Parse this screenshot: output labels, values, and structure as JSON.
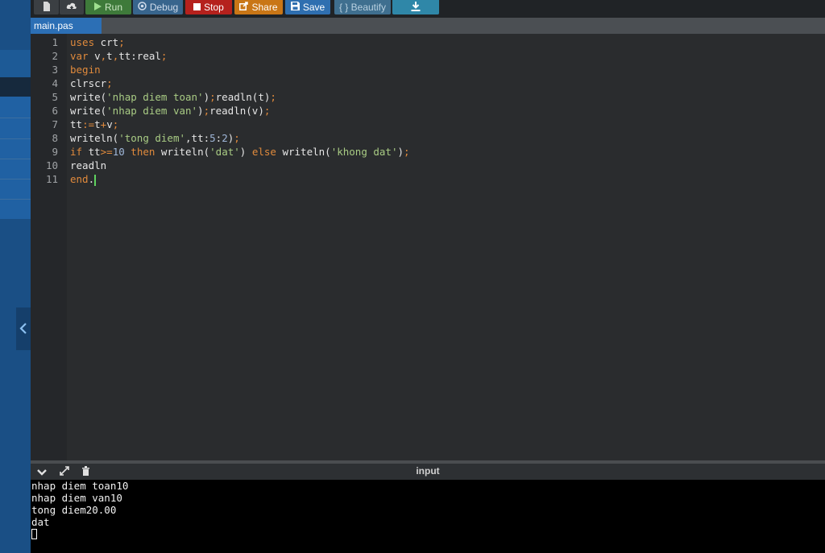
{
  "toolbar": {
    "buttons": [
      {
        "id": "new-file",
        "label": "",
        "icon": "file-icon",
        "color": "#3b3f43"
      },
      {
        "id": "upload",
        "label": "",
        "icon": "upload-cloud-icon",
        "color": "#3b3f43"
      },
      {
        "id": "run",
        "label": "Run",
        "icon": "play-icon",
        "color": "#3e7a3a"
      },
      {
        "id": "debug",
        "label": "Debug",
        "icon": "debug-icon",
        "color": "#38658d"
      },
      {
        "id": "stop",
        "label": "Stop",
        "icon": "stop-icon",
        "color": "#b5211d"
      },
      {
        "id": "share",
        "label": "Share",
        "icon": "share-icon",
        "color": "#c97616"
      },
      {
        "id": "save",
        "label": "Save",
        "icon": "floppy-icon",
        "color": "#2f6fb0"
      },
      {
        "id": "beautify",
        "label": "{ } Beautify",
        "icon": "",
        "color": "#3f6f8f"
      },
      {
        "id": "download",
        "label": "",
        "icon": "download-icon",
        "color": "#2f87a8"
      }
    ]
  },
  "tab": {
    "label": "main.pas"
  },
  "code": {
    "line_numbers": [
      "1",
      "2",
      "3",
      "4",
      "5",
      "6",
      "7",
      "8",
      "9",
      "10",
      "11"
    ],
    "lines": [
      [
        {
          "t": "uses",
          "c": "kw"
        },
        {
          "t": " crt",
          "c": ""
        },
        {
          "t": ";",
          "c": "op"
        }
      ],
      [
        {
          "t": "var",
          "c": "kw"
        },
        {
          "t": " v",
          "c": ""
        },
        {
          "t": ",",
          "c": "op"
        },
        {
          "t": "t",
          "c": ""
        },
        {
          "t": ",",
          "c": "op"
        },
        {
          "t": "tt:real",
          "c": ""
        },
        {
          "t": ";",
          "c": "op"
        }
      ],
      [
        {
          "t": "begin",
          "c": "kw"
        }
      ],
      [
        {
          "t": "clrscr",
          "c": ""
        },
        {
          "t": ";",
          "c": "op"
        }
      ],
      [
        {
          "t": "write(",
          "c": ""
        },
        {
          "t": "'nhap diem toan'",
          "c": "str"
        },
        {
          "t": ")",
          "c": ""
        },
        {
          "t": ";",
          "c": "op"
        },
        {
          "t": "readln(t)",
          "c": ""
        },
        {
          "t": ";",
          "c": "op"
        }
      ],
      [
        {
          "t": "write(",
          "c": ""
        },
        {
          "t": "'nhap diem van'",
          "c": "str"
        },
        {
          "t": ")",
          "c": ""
        },
        {
          "t": ";",
          "c": "op"
        },
        {
          "t": "readln(v)",
          "c": ""
        },
        {
          "t": ";",
          "c": "op"
        }
      ],
      [
        {
          "t": "tt",
          "c": ""
        },
        {
          "t": ":=",
          "c": "op"
        },
        {
          "t": "t",
          "c": ""
        },
        {
          "t": "+",
          "c": "op"
        },
        {
          "t": "v",
          "c": ""
        },
        {
          "t": ";",
          "c": "op"
        }
      ],
      [
        {
          "t": "writeln(",
          "c": ""
        },
        {
          "t": "'tong diem'",
          "c": "str"
        },
        {
          "t": ",tt:",
          "c": ""
        },
        {
          "t": "5",
          "c": "num"
        },
        {
          "t": ":",
          "c": ""
        },
        {
          "t": "2",
          "c": "num"
        },
        {
          "t": ")",
          "c": ""
        },
        {
          "t": ";",
          "c": "op"
        }
      ],
      [
        {
          "t": "if",
          "c": "kw"
        },
        {
          "t": " tt",
          "c": ""
        },
        {
          "t": ">=",
          "c": "op"
        },
        {
          "t": "10",
          "c": "num"
        },
        {
          "t": " ",
          "c": ""
        },
        {
          "t": "then",
          "c": "kw"
        },
        {
          "t": " writeln(",
          "c": ""
        },
        {
          "t": "'dat'",
          "c": "str"
        },
        {
          "t": ") ",
          "c": ""
        },
        {
          "t": "else",
          "c": "kw"
        },
        {
          "t": " writeln(",
          "c": ""
        },
        {
          "t": "'khong dat'",
          "c": "str"
        },
        {
          "t": ")",
          "c": ""
        },
        {
          "t": ";",
          "c": "op"
        }
      ],
      [
        {
          "t": "readln",
          "c": ""
        }
      ],
      [
        {
          "t": "end",
          "c": "kw"
        },
        {
          "t": ".",
          "c": ""
        }
      ]
    ]
  },
  "console": {
    "title": "input",
    "icons": [
      "chevron-down-icon",
      "expand-icon",
      "clear-icon"
    ],
    "output": [
      "nhap diem toan10",
      "nhap diem van10",
      "tong diem20.00",
      "dat"
    ]
  },
  "colors": {
    "sidebar": "#1a4f85",
    "tab_active": "#2c6fb5",
    "keyword": "#e08a3c",
    "string": "#a9cc84"
  }
}
